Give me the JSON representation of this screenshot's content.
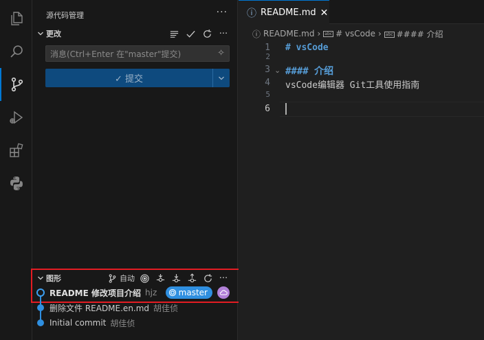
{
  "activity_bar": {
    "icons": [
      "explorer-icon",
      "search-icon",
      "source-control-icon",
      "run-debug-icon",
      "extensions-icon",
      "python-icon"
    ]
  },
  "sidebar": {
    "title": "源代码管理",
    "more": "···",
    "changes": {
      "label": "更改",
      "message_placeholder": "消息(Ctrl+Enter 在\"master\"提交)",
      "commit_label": "✓ 提交"
    },
    "graph": {
      "label": "图形",
      "auto_label": "自动",
      "commits": [
        {
          "message": "README 修改项目介绍",
          "author": "hjz"
        },
        {
          "message": "删除文件 README.en.md",
          "author": "胡佳侦"
        },
        {
          "message": "Initial commit",
          "author": "胡佳侦"
        }
      ],
      "branch": "master"
    }
  },
  "editor": {
    "tab": {
      "label": "README.md",
      "close": "✕"
    },
    "breadcrumb": {
      "file": "README.md",
      "sym1": "# vsCode",
      "sym2": "#### 介绍"
    },
    "lines": [
      {
        "num": "1",
        "text": "# vsCode"
      },
      {
        "num": "2",
        "text": ""
      },
      {
        "num": "3",
        "text": "#### 介绍"
      },
      {
        "num": "4",
        "text": "vsCode编辑器 Git工具使用指南"
      },
      {
        "num": "5",
        "text": ""
      },
      {
        "num": "6",
        "text": ""
      }
    ]
  },
  "colors": {
    "accent": "#0078d4",
    "graph_blue": "#2f8fe0",
    "highlight_border": "#e51c23",
    "heading": "#569cd6"
  }
}
